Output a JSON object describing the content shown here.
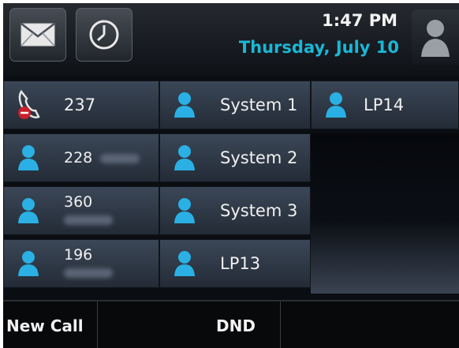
{
  "header": {
    "time": "1:47 PM",
    "date": "Thursday, July 10",
    "buttons": [
      {
        "icon": "envelope-icon"
      },
      {
        "icon": "clock-icon"
      }
    ],
    "avatar_icon": "user-icon"
  },
  "line_keys": [
    {
      "label": "237",
      "icon": "phone-hangup-icon",
      "status_color": "#c8202a"
    },
    {
      "label": "System 1",
      "icon": "user-icon"
    },
    {
      "label": "LP14",
      "icon": "user-icon"
    },
    {
      "label": "228",
      "icon": "user-icon"
    },
    {
      "label": "System 2",
      "icon": "user-icon"
    },
    {
      "label": "360",
      "icon": "user-icon"
    },
    {
      "label": "System 3",
      "icon": "user-icon"
    },
    {
      "label": "196",
      "icon": "user-icon"
    },
    {
      "label": "LP13",
      "icon": "user-icon"
    }
  ],
  "softkeys": [
    {
      "label": "New Call"
    },
    {
      "label": "DND"
    }
  ],
  "colors": {
    "accent": "#1ab7d6",
    "contact_icon": "#2ab0e4"
  }
}
